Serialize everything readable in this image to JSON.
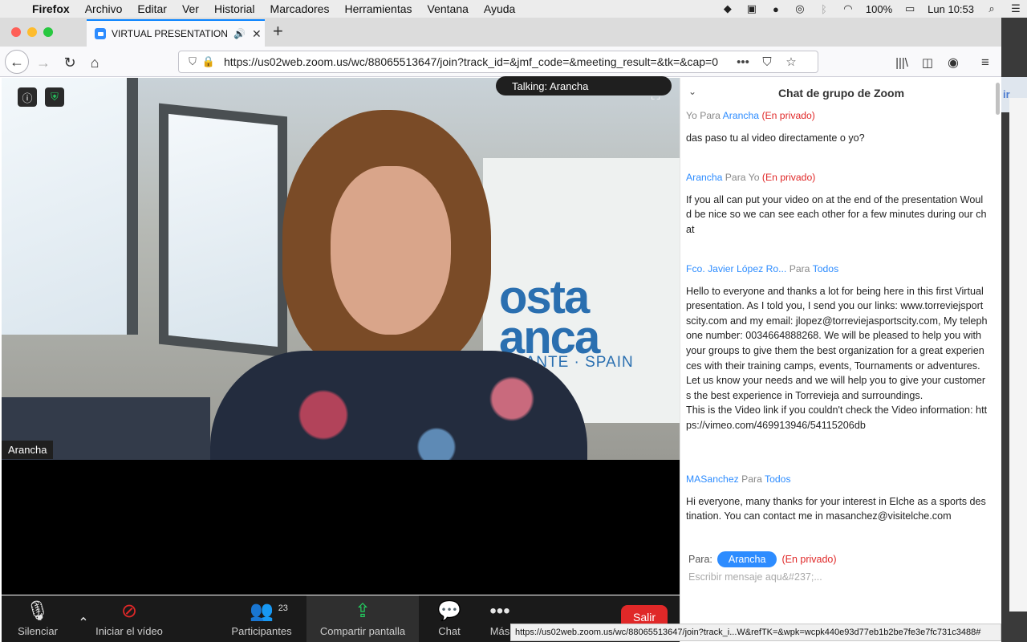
{
  "menubar": {
    "apple": "",
    "items": [
      "Firefox",
      "Archivo",
      "Editar",
      "Ver",
      "Historial",
      "Marcadores",
      "Herramientas",
      "Ventana",
      "Ayuda"
    ],
    "battery": "100%",
    "clock": "Lun 10:53"
  },
  "browser": {
    "tab_title": "VIRTUAL PRESENTATION OF",
    "url": "https://us02web.zoom.us/wc/88065513647/join?track_id=&jmf_code=&meeting_result=&tk=&cap=0",
    "status_url": "https://us02web.zoom.us/wc/88065513647/join?track_i...W&refTK=&wpk=wcpk440e93d77eb1b2be7fe3e7fc731c3488#"
  },
  "desktop": {
    "peek_text": "ir"
  },
  "video": {
    "talking": "Talking: Arancha",
    "name_label": "Arancha",
    "banner_line1": "osta",
    "banner_line2": "anca",
    "banner_line3": "LICANTE · SPAIN"
  },
  "toolbar": {
    "mute": "Silenciar",
    "start_video": "Iniciar el vídeo",
    "participants": "Participantes",
    "participants_count": "23",
    "share": "Compartir pantalla",
    "chat": "Chat",
    "more": "Más",
    "leave": "Salir"
  },
  "chat": {
    "title": "Chat de grupo de Zoom",
    "messages": [
      {
        "from": "Yo",
        "para": "Para",
        "to": "Arancha",
        "privacy": "(En privado)",
        "text": "das paso tu al video directamente o yo?"
      },
      {
        "from": "Arancha",
        "para": "Para",
        "to": "Yo",
        "privacy": "(En privado)",
        "text": "If you all can put your video on at the end of the presentation Would be nice so we can see each other for a few minutes during our chat"
      },
      {
        "from": "Fco. Javier López Ro...",
        "para": "Para",
        "to": "Todos",
        "privacy": "",
        "text": "Hello to everyone and thanks a lot for being here in this first Virtual presentation. As I told you, I send you our links: www.torreviejsportscity.com and my email: jlopez@torreviejasportscity.com, My telephone number: 0034664888268. We will be pleased to help you with your groups to give them the best organization for a great experiences with their training camps, events, Tournaments or adventures. Let us know your needs and we will help you to give your customers the best experience in Torrevieja and surroundings.",
        "text2": "This is the Video link if you couldn't check the Video information: https://vimeo.com/469913946/54115206db"
      },
      {
        "from": "MASanchez",
        "para": "Para",
        "to": "Todos",
        "privacy": "",
        "text": "Hi everyone, many thanks for your interest in Elche as a sports destination. You can contact me in masanchez@visitelche.com"
      }
    ],
    "compose": {
      "to_label": "Para:",
      "recipient": "Arancha",
      "privacy": "(En privado)",
      "placeholder": "Escribir mensaje aqu&#237;..."
    }
  }
}
